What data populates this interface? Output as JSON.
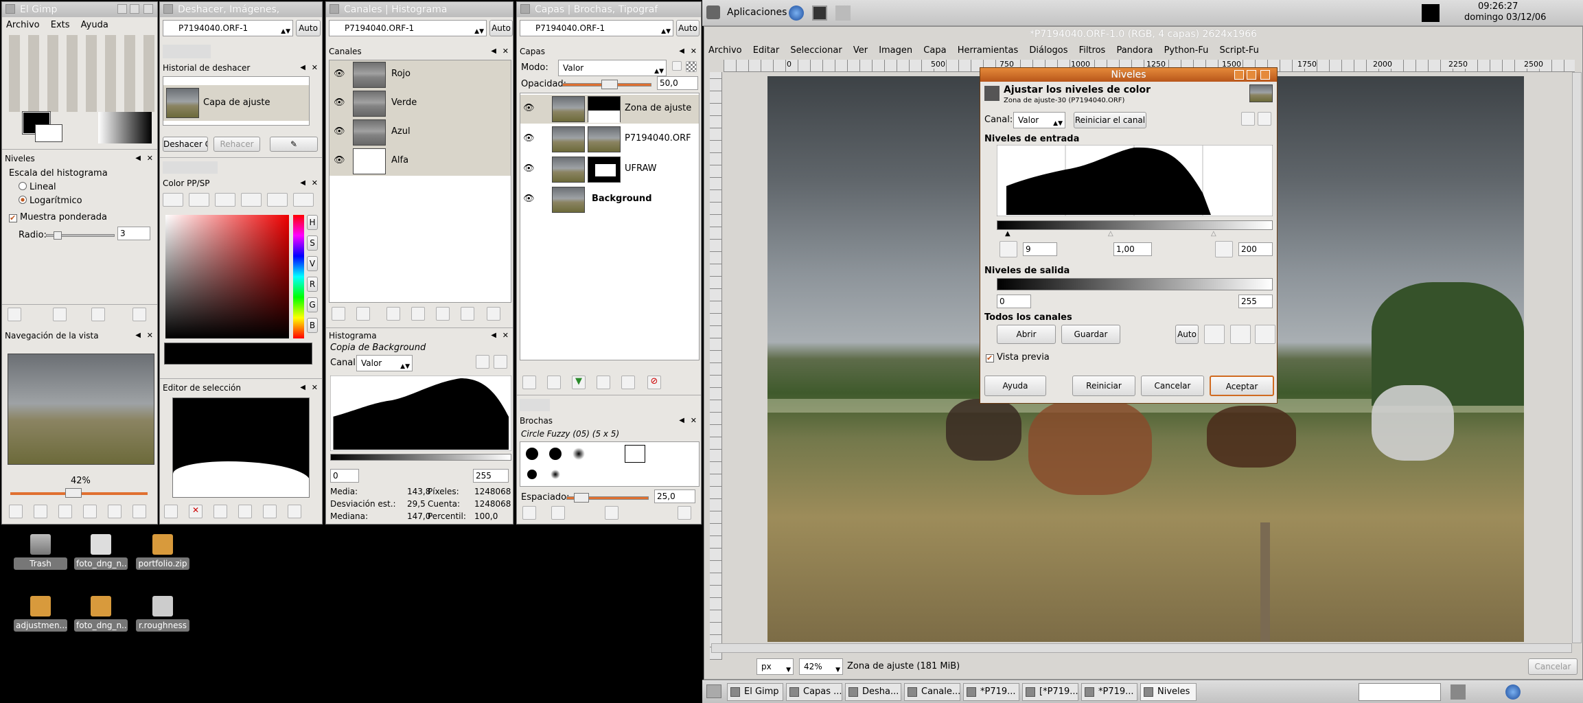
{
  "toolbox": {
    "title": "El Gimp",
    "menu": [
      "Archivo",
      "Exts",
      "Ayuda"
    ]
  },
  "levels_dock": {
    "title": "Niveles",
    "scale_label": "Escala del histograma",
    "opt_linear": "Lineal",
    "opt_log": "Logarítmico",
    "weighted": "Muestra ponderada",
    "radius_label": "Radio:",
    "radius_value": "3"
  },
  "nav_dock": {
    "title": "Navegación de la vista",
    "zoom": "42%"
  },
  "undo_win": {
    "title": "Deshacer, Imágenes,",
    "image": "P7194040.ORF-1",
    "auto": "Auto",
    "hist_title": "Historial de deshacer",
    "item": "Capa de ajuste",
    "undo_btn": "Deshacer C",
    "redo_btn": "Rehacer"
  },
  "color_dock": {
    "title": "Color PP/SP",
    "letters": [
      "H",
      "S",
      "V",
      "R",
      "G",
      "B"
    ]
  },
  "sel_editor": {
    "title": "Editor de selección"
  },
  "channels_win": {
    "title": "Canales | Histograma",
    "image": "P7194040.ORF-1",
    "auto": "Auto",
    "hdr": "Canales",
    "channels": [
      "Rojo",
      "Verde",
      "Azul",
      "Alfa"
    ]
  },
  "histogram": {
    "title": "Histograma",
    "subtitle": "Copia de Background",
    "channel_label": "Canal:",
    "channel": "Valor",
    "low": "0",
    "high": "255",
    "stats": [
      [
        "Media:",
        "143,8",
        "Píxeles:",
        "1248068"
      ],
      [
        "Desviación est.:",
        "29,5",
        "Cuenta:",
        "1248068"
      ],
      [
        "Mediana:",
        "147,0",
        "Percentil:",
        "100,0"
      ]
    ]
  },
  "layers_win": {
    "title": "Capas | Brochas, Tipograf",
    "image": "P7194040.ORF-1",
    "auto": "Auto",
    "hdr": "Capas",
    "mode_label": "Modo:",
    "mode": "Valor",
    "opacity_label": "Opacidad:",
    "opacity": "50,0",
    "layers": [
      "Zona de ajuste",
      "P7194040.ORF",
      "UFRAW",
      "Background"
    ]
  },
  "brushes": {
    "title": "Brochas",
    "current": "Circle Fuzzy (05) (5 x 5)",
    "spacing_label": "Espaciado:",
    "spacing": "25,0"
  },
  "desktop_icons": [
    "Trash",
    "foto_dng_n...",
    "portfolio.zip",
    "adjustmen...",
    "foto_dng_n...",
    "r.roughness"
  ],
  "topbar": {
    "apps": "Aplicaciones",
    "time": "09:26:27",
    "date": "domingo 03/12/06"
  },
  "image_win": {
    "title": "*P7194040.ORF-1.0 (RGB, 4 capas) 2624x1966",
    "menu": [
      "Archivo",
      "Editar",
      "Seleccionar",
      "Ver",
      "Imagen",
      "Capa",
      "Herramientas",
      "Diálogos",
      "Filtros",
      "Pandora",
      "Python-Fu",
      "Script-Fu"
    ],
    "ruler_marks": [
      "0",
      "500",
      "750",
      "1000",
      "1250",
      "1500",
      "1750",
      "2000",
      "2250",
      "2500"
    ],
    "unit": "px",
    "zoom": "42%",
    "status": "Zona de ajuste  (181 MiB)",
    "cancel": "Cancelar"
  },
  "levels_dialog": {
    "title": "Niveles",
    "heading": "Ajustar los niveles de color",
    "sub": "Zona de ajuste-30 (P7194040.ORF)",
    "channel_label": "Canal:",
    "channel": "Valor",
    "reset_channel": "Reiniciar el canal",
    "input_label": "Niveles de entrada",
    "in_low": "9",
    "in_gamma": "1,00",
    "in_high": "200",
    "output_label": "Niveles de salida",
    "out_low": "0",
    "out_high": "255",
    "all_channels": "Todos los canales",
    "open": "Abrir",
    "save": "Guardar",
    "auto": "Auto",
    "preview": "Vista previa",
    "help": "Ayuda",
    "reset": "Reiniciar",
    "cancel": "Cancelar",
    "ok": "Aceptar"
  },
  "taskbar": [
    "El Gimp",
    "Capas ...",
    "Desha...",
    "Canale...",
    "*P719...",
    "[*P719...",
    "*P719...",
    "Niveles"
  ]
}
